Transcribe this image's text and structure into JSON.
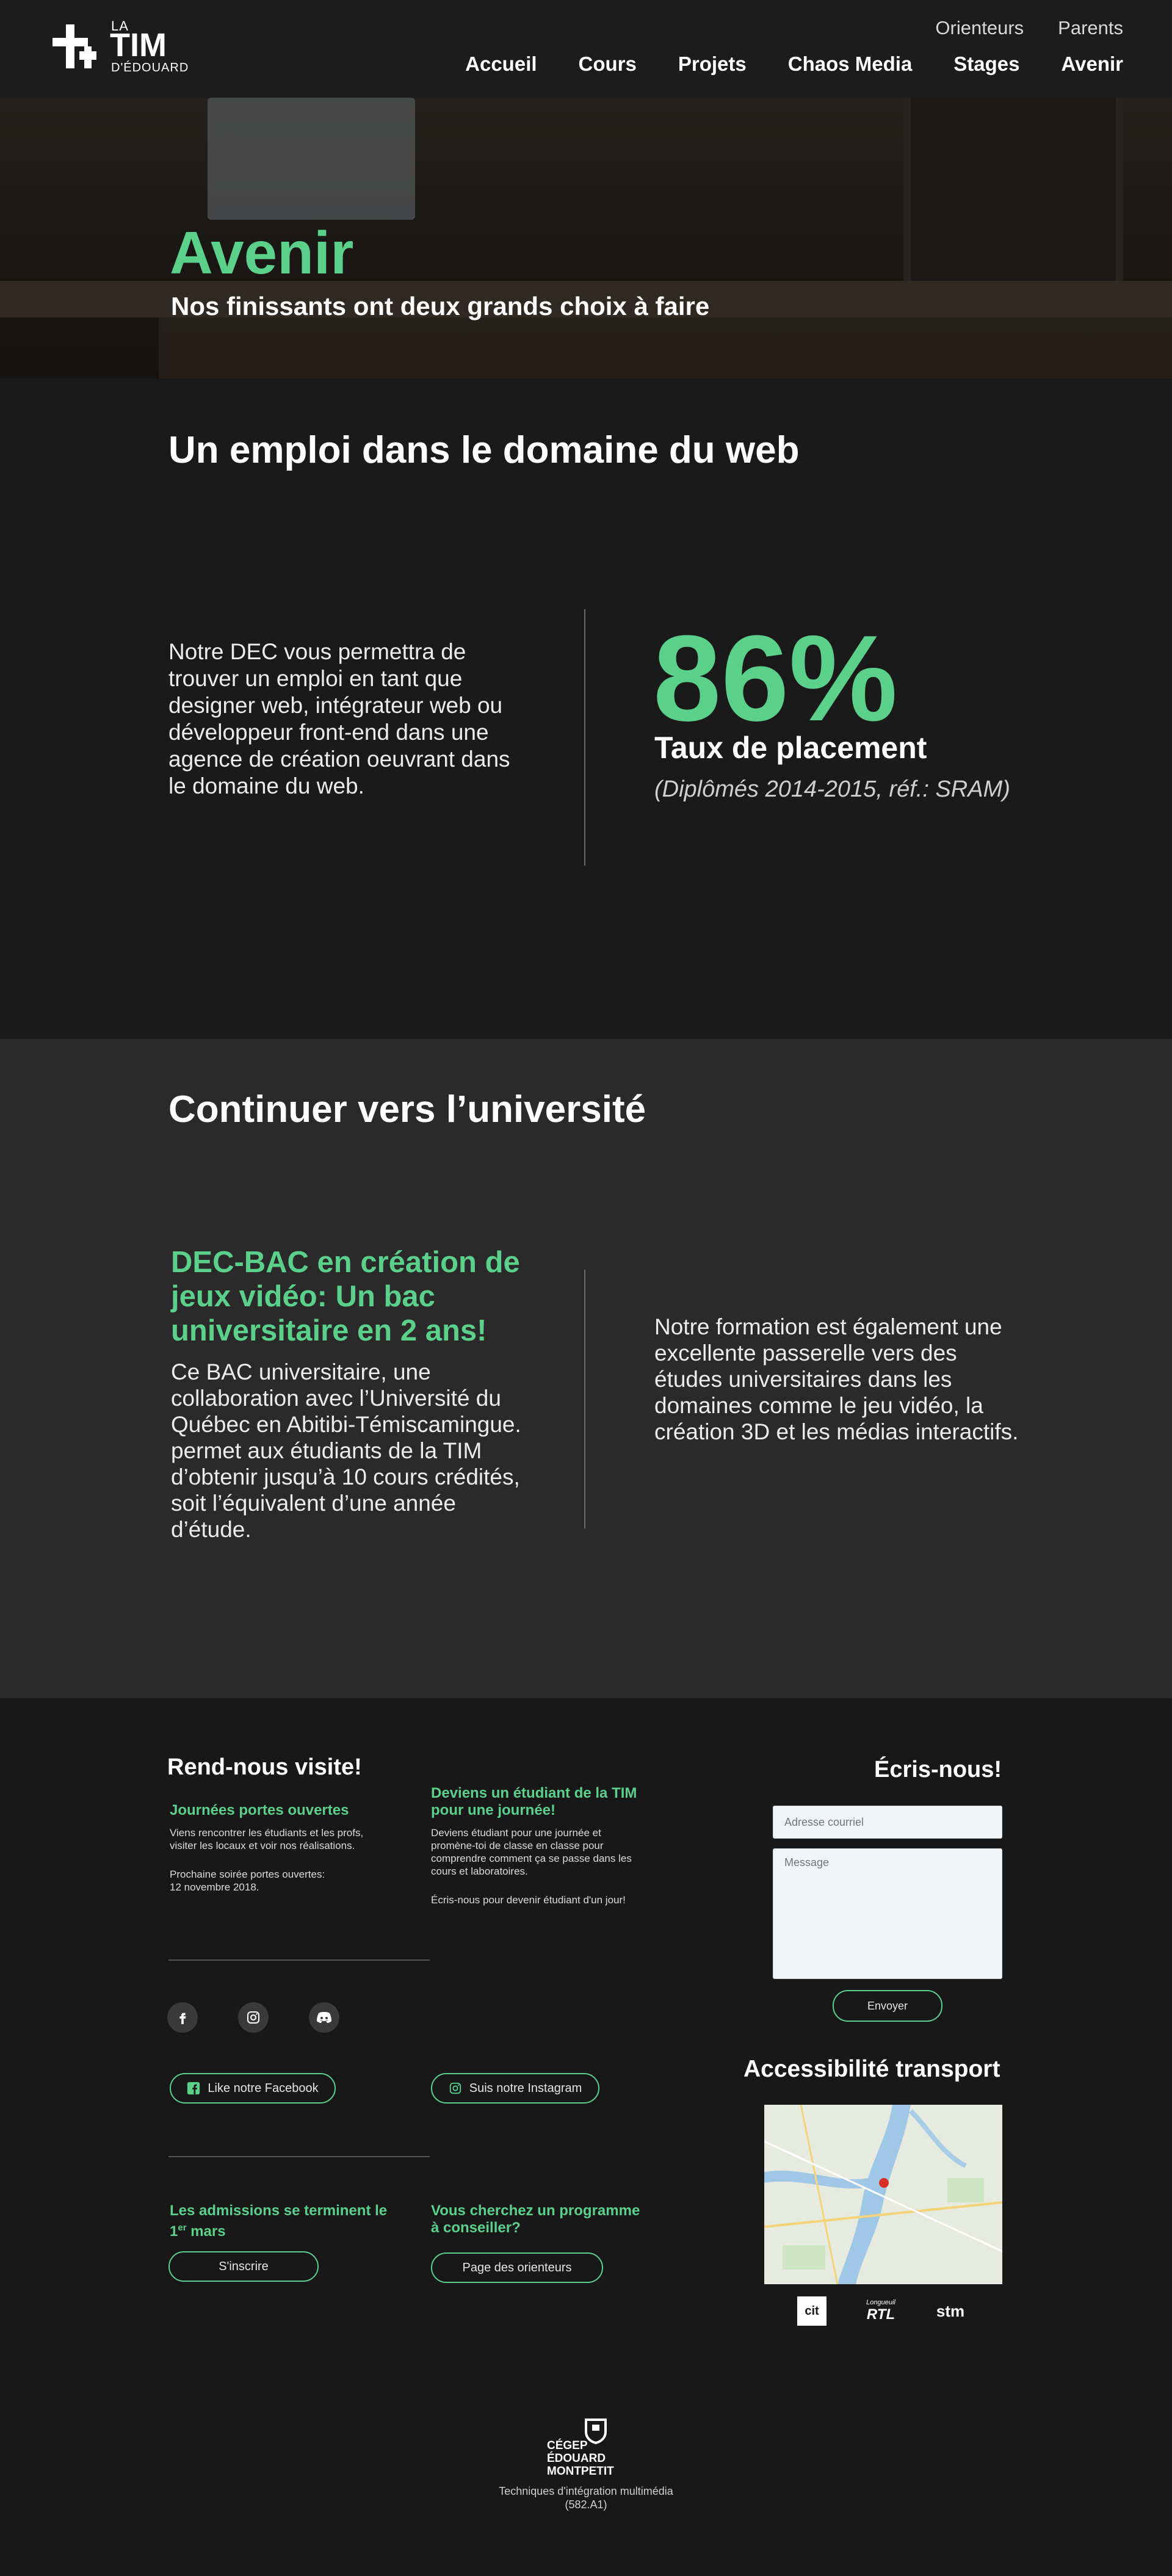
{
  "header": {
    "logo": {
      "la": "LA",
      "tim": "TIM",
      "edouard": "D'ÉDOUARD"
    },
    "top_links": [
      "Orienteurs",
      "Parents"
    ],
    "nav": [
      "Accueil",
      "Cours",
      "Projets",
      "Chaos Media",
      "Stages",
      "Avenir"
    ]
  },
  "hero": {
    "title": "Avenir",
    "subtitle": "Nos finissants ont deux grands choix à faire"
  },
  "emploi": {
    "heading": "Un emploi dans le domaine du web",
    "paragraph": "Notre DEC vous permettra de trouver un emploi en tant que designer web, intégrateur web ou développeur front-end dans une agence de création oeuvrant dans le domaine du web.",
    "stat_value": "86%",
    "stat_label": "Taux de placement",
    "stat_note": "(Diplômés 2014-2015, réf.: SRAM)"
  },
  "universite": {
    "heading": "Continuer vers l’université",
    "dec_bac_title": "DEC-BAC en création de jeux vidéo: Un bac universitaire en 2 ans!",
    "dec_bac_text": "Ce BAC universitaire, une collaboration avec l’Université du Québec en Abitibi-Témiscamingue. permet aux étudiants de la TIM d’obtenir jusqu’à 10 cours crédités, soit l’équivalent d’une année d’étude.",
    "right_text": "Notre formation est également une excellente passerelle vers des études universitaires dans les domaines comme le jeu vidéo, la création 3D et les médias interactifs."
  },
  "footer": {
    "visit_title": "Rend-nous visite!",
    "portes_title": "Journées portes ouvertes",
    "portes_text": "Viens rencontrer les étudiants et les profs, visiter les locaux et voir nos réalisations.",
    "portes_date_label": "Prochaine soirée portes ouvertes:",
    "portes_date": "12 novembre 2018.",
    "etudiant_title": "Deviens un étudiant de la TIM pour une journée!",
    "etudiant_text": "Deviens étudiant pour une journée et promène-toi de classe en classe pour comprendre comment ça se passe dans les cours et laboratoires.",
    "etudiant_cta": "Écris-nous pour devenir étudiant d'un jour!",
    "facebook_label": "Like notre Facebook",
    "instagram_label": "Suis notre Instagram",
    "admissions_title_main": "Les admissions se terminent le 1",
    "admissions_title_sup": "er",
    "admissions_title_end": " mars",
    "inscrire_label": "S'inscrire",
    "conseiller_title": "Vous cherchez un programme à conseiller?",
    "orienteurs_label": "Page des orienteurs",
    "contact_title": "Écris-nous!",
    "email_placeholder": "Adresse courriel",
    "message_placeholder": "Message",
    "send_label": "Envoyer",
    "transport_title": "Accessibilité transport",
    "transit": [
      "cit",
      "Longueuil",
      "RTL",
      "stm"
    ],
    "cegep_lines": [
      "CÉGEP",
      "ÉDOUARD",
      "MONTPETIT"
    ],
    "program_name": "Techniques d'intégration multimédia",
    "program_code": "(582.A1)"
  },
  "colors": {
    "accent": "#5bd08b",
    "background": "#181818",
    "section_alt": "#2a2a2a"
  }
}
